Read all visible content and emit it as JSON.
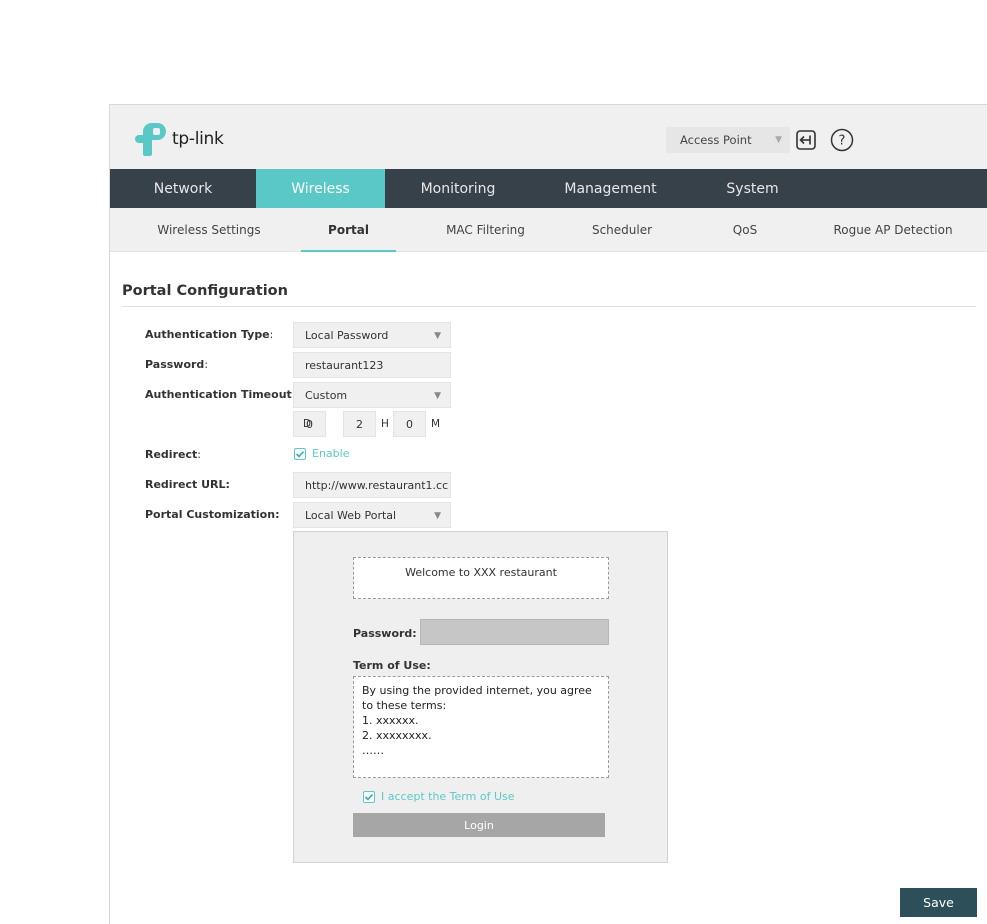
{
  "header": {
    "logo_text": "tp-link",
    "mode_select": "Access Point",
    "brand_color": "#5bc8c8"
  },
  "main_nav": {
    "items": [
      "Network",
      "Wireless",
      "Monitoring",
      "Management",
      "System"
    ],
    "active": "Wireless"
  },
  "sub_nav": {
    "items": [
      "Wireless Settings",
      "Portal",
      "MAC Filtering",
      "Scheduler",
      "QoS",
      "Rogue AP Detection"
    ],
    "active": "Portal"
  },
  "form": {
    "title": "Portal Configuration",
    "auth_type_label": "Authentication Type",
    "auth_type_value": "Local Password",
    "password_label": "Password",
    "password_value": "restaurant123",
    "auth_timeout_label": "Authentication Timeout:",
    "auth_timeout_value": "Custom",
    "timeout_days": "0",
    "timeout_days_unit": "D",
    "timeout_hours": "2",
    "timeout_hours_unit": "H",
    "timeout_minutes": "0",
    "timeout_minutes_unit": "M",
    "redirect_label": "Redirect",
    "redirect_enable": "Enable",
    "redirect_url_label": "Redirect URL:",
    "redirect_url_value": "http://www.restaurant1.cc",
    "portal_custom_label": "Portal Customization:",
    "portal_custom_value": "Local Web Portal"
  },
  "preview": {
    "welcome": "Welcome to XXX restaurant",
    "password_label": "Password:",
    "term_label": "Term of Use:",
    "terms_lines": [
      "By using the provided internet, you agree to these terms:",
      "1. xxxxxx.",
      "2. xxxxxxxx.",
      "……"
    ],
    "accept_label": "I accept the Term of Use",
    "login_label": "Login"
  },
  "footer": {
    "save_label": "Save"
  }
}
